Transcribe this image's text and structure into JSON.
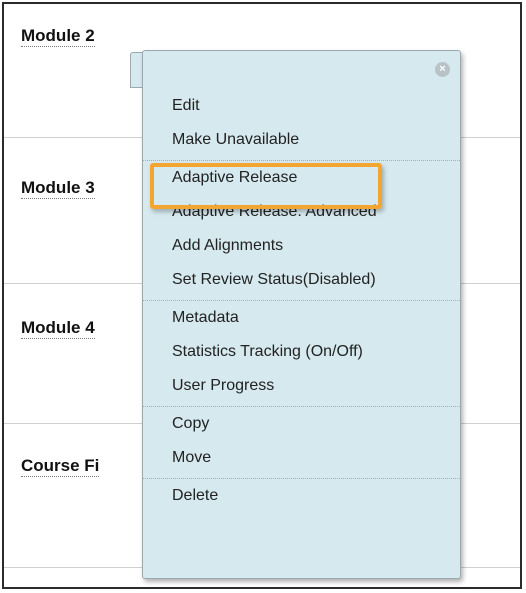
{
  "rows": [
    {
      "title": "Module 2"
    },
    {
      "title": "Module 3"
    },
    {
      "title": "Module 4"
    },
    {
      "title": "Course Fi"
    }
  ],
  "menu": {
    "close_icon": "close-icon",
    "groups": [
      [
        "Edit",
        "Make Unavailable"
      ],
      [
        "Adaptive Release",
        "Adaptive Release: Advanced",
        "Add Alignments",
        "Set Review Status(Disabled)"
      ],
      [
        "Metadata",
        "Statistics Tracking (On/Off)",
        "User Progress"
      ],
      [
        "Copy",
        "Move"
      ],
      [
        "Delete"
      ]
    ],
    "highlighted_item": "Adaptive Release"
  },
  "colors": {
    "menu_background": "#d5e9ef",
    "highlight_border": "#f3a531"
  }
}
